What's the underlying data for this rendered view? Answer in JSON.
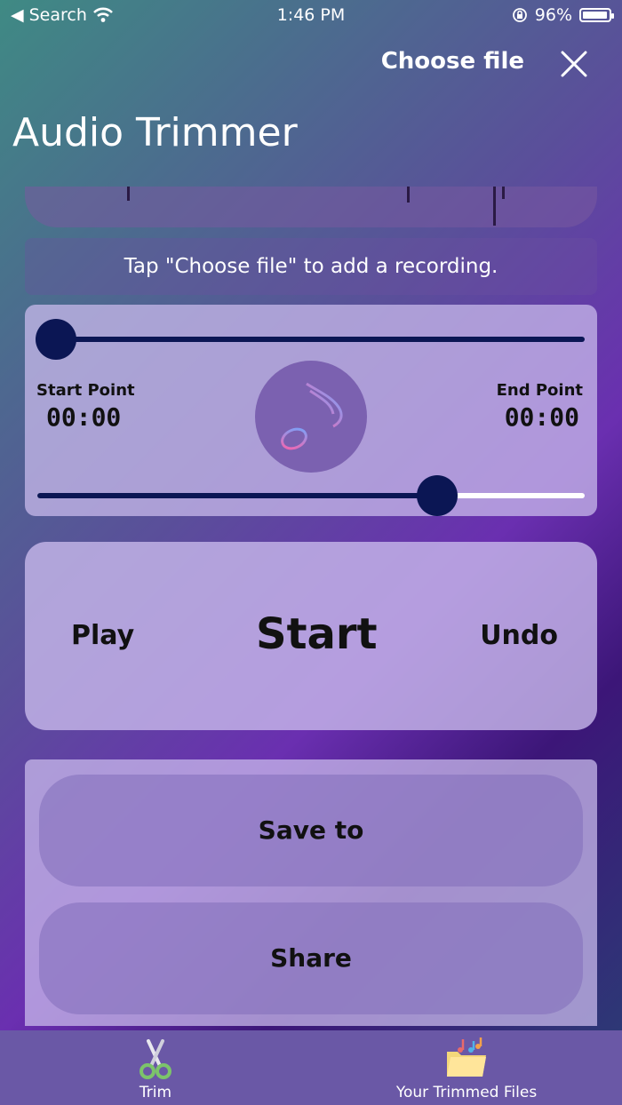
{
  "status_bar": {
    "back_label": "Search",
    "time": "1:46 PM",
    "battery_percent": "96%",
    "battery_level": 0.96
  },
  "nav": {
    "choose_file_label": "Choose file"
  },
  "title": "Audio Trimmer",
  "hint_text": "Tap \"Choose file\" to add a recording.",
  "trim": {
    "start_label": "Start Point",
    "start_value": "00:00",
    "end_label": "End Point",
    "end_value": "00:00",
    "start_slider_fraction": 0.0,
    "end_slider_fraction": 0.73
  },
  "controls": {
    "play_label": "Play",
    "start_label": "Start",
    "undo_label": "Undo"
  },
  "actions": {
    "save_label": "Save to",
    "share_label": "Share"
  },
  "tabs": [
    {
      "label": "Trim",
      "icon": "scissors-icon"
    },
    {
      "label": "Your Trimmed Files",
      "icon": "folder-music-icon"
    }
  ],
  "colors": {
    "slider_thumb": "#0b1654",
    "tab_bar": "#6a58a6"
  }
}
